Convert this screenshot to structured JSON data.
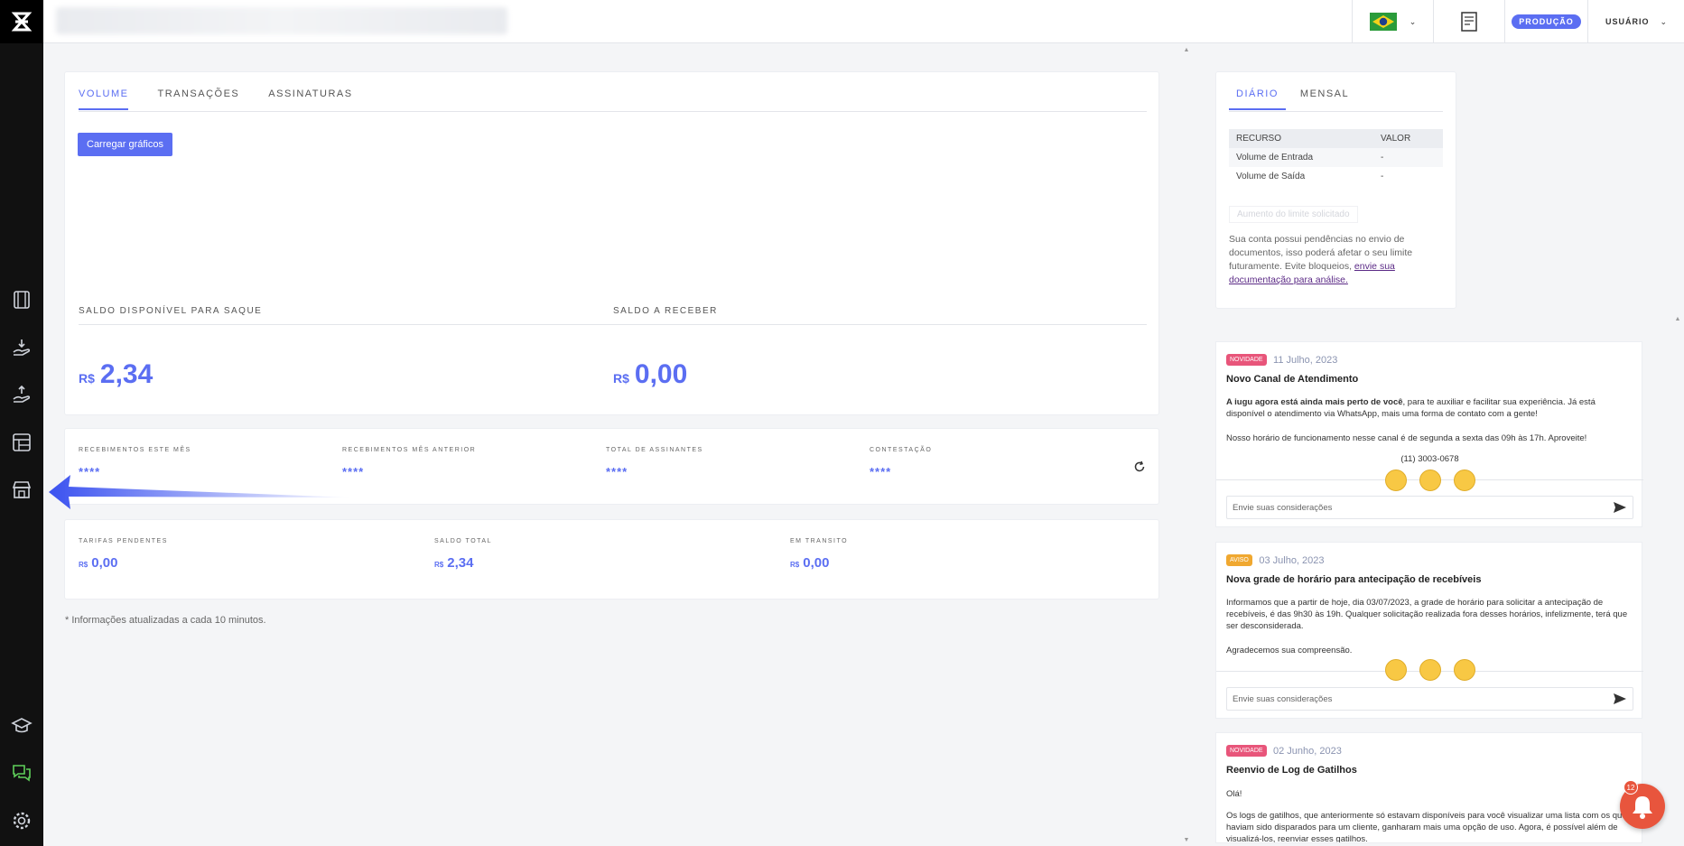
{
  "topbar": {
    "env_badge": "PRODUÇÃO",
    "user_label": "USUÁRIO"
  },
  "icons": {
    "logo": "iugu-logo-icon",
    "flag": "brazil-flag-icon",
    "docs": "document-icon"
  },
  "main": {
    "tabs": [
      {
        "label": "VOLUME",
        "active": true
      },
      {
        "label": "TRANSAÇÕES",
        "active": false
      },
      {
        "label": "ASSINATURAS",
        "active": false
      }
    ],
    "load_button": "Carregar gráficos",
    "saldo_disponivel_label": "SALDO DISPONÍVEL PARA SAQUE",
    "saldo_receber_label": "SALDO A RECEBER",
    "currency": "R$",
    "saldo_disponivel_value": "2,34",
    "saldo_receber_value": "0,00",
    "stats": [
      {
        "label": "RECEBIMENTOS ESTE MÊS",
        "value": "****"
      },
      {
        "label": "RECEBIMENTOS MÊS ANTERIOR",
        "value": "****"
      },
      {
        "label": "TOTAL DE ASSINANTES",
        "value": "****"
      },
      {
        "label": "CONTESTAÇÃO",
        "value": "****"
      }
    ],
    "totals": [
      {
        "label": "TARIFAS PENDENTES",
        "value": "0,00"
      },
      {
        "label": "SALDO TOTAL",
        "value": "2,34"
      },
      {
        "label": "EM TRANSITO",
        "value": "0,00"
      }
    ],
    "footnote": "* Informações atualizadas a cada 10 minutos."
  },
  "limits": {
    "tabs": [
      {
        "label": "DIÁRIO",
        "active": true
      },
      {
        "label": "MENSAL",
        "active": false
      }
    ],
    "columns": [
      "RECURSO",
      "VALOR"
    ],
    "rows": [
      {
        "recurso": "Volume de Entrada",
        "valor": "-"
      },
      {
        "recurso": "Volume de Saída",
        "valor": "-"
      }
    ],
    "increase_button": "Aumento do limite solicitado",
    "pending_text": "Sua conta possui pendências no envio de documentos, isso poderá afetar o seu limite futuramente. Evite bloqueios,",
    "pending_link": "envie sua documentação para análise."
  },
  "news": [
    {
      "badge": "NOVIDADE",
      "badge_color": "#e8557a",
      "date": "11 Julho, 2023",
      "title": "Novo Canal de Atendimento",
      "p1_bold": "A iugu agora está ainda mais perto de você",
      "p1_rest": ", para te auxiliar e facilitar sua experiência. Já está disponível o atendimento via WhatsApp, mais uma forma de contato com a gente!",
      "p2": "Nosso horário de funcionamento nesse canal é de segunda a sexta das 09h às 17h. Aproveite!",
      "phone": "(11) 3003-0678",
      "comment_placeholder": "Envie suas considerações"
    },
    {
      "badge": "AVISO",
      "badge_color": "#f0a830",
      "date": "03 Julho, 2023",
      "title": "Nova grade de horário para antecipação de recebíveis",
      "p1": "Informamos que a partir de hoje, dia 03/07/2023, a grade de horário para solicitar a antecipação de recebíveis, é das 9h30 às 19h. Qualquer solicitação realizada fora desses horários, infelizmente, terá que ser desconsiderada.",
      "p2": "Agradecemos sua compreensão.",
      "comment_placeholder": "Envie suas considerações"
    },
    {
      "badge": "NOVIDADE",
      "badge_color": "#e8557a",
      "date": "02 Junho, 2023",
      "title": "Reenvio de Log de Gatilhos",
      "p1": "Olá!",
      "p2": "Os logs de gatilhos, que anteriormente só estavam disponíveis para você visualizar uma lista com os que haviam sido disparados para um cliente, ganharam mais uma opção de uso. Agora, é possível além de visualizá-los, reenviar esses gatilhos."
    }
  ],
  "notifications": {
    "count": "12"
  }
}
